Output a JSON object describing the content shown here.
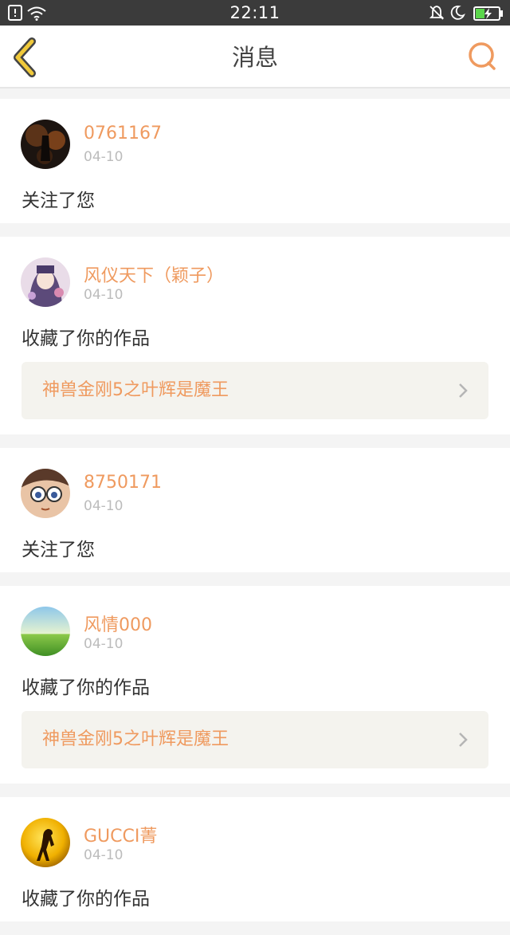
{
  "status_bar": {
    "time": "22:11",
    "icons": [
      "sim-icon",
      "wifi-icon",
      "mute-icon",
      "moon-icon",
      "battery-charging-icon"
    ]
  },
  "header": {
    "title": "消息",
    "back_icon": "chevron-left-icon",
    "search_icon": "search-icon"
  },
  "messages": [
    {
      "user": "0761167",
      "date": "04-10",
      "action": "关注了您"
    },
    {
      "user": "风仪天下（颖子）",
      "date": "04-10",
      "action": "收藏了你的作品",
      "work": "神兽金刚5之叶辉是魔王"
    },
    {
      "user": "8750171",
      "date": "04-10",
      "action": "关注了您"
    },
    {
      "user": "风情000",
      "date": "04-10",
      "action": "收藏了你的作品",
      "work": "神兽金刚5之叶辉是魔王"
    },
    {
      "user": "GUCCI菁",
      "date": "04-10",
      "action": "收藏了你的作品"
    }
  ],
  "colors": {
    "accent": "#ef9a5f",
    "status_bar": "#3b3b3b",
    "back_icon": "#f0c93a",
    "work_bg": "#f4f3ee"
  }
}
